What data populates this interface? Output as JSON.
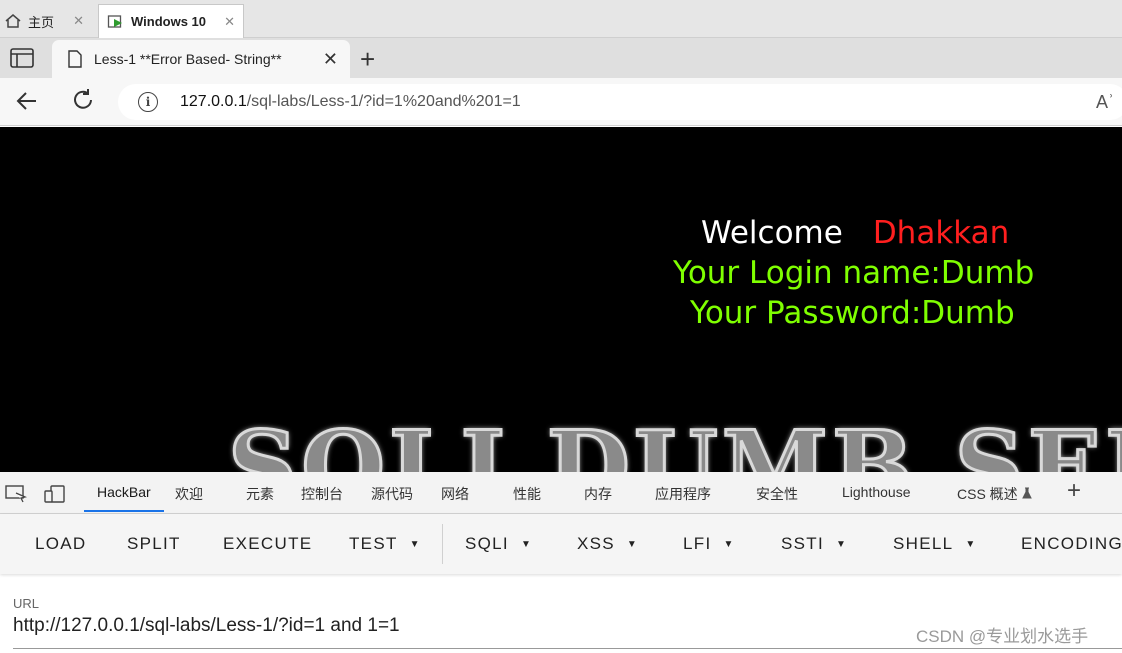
{
  "vm": {
    "tabs": [
      {
        "label": "主页",
        "icon": "home-icon"
      },
      {
        "label": "Windows 10",
        "icon": "vm-icon"
      }
    ],
    "close_glyph": "✕"
  },
  "browser": {
    "tab_title": "Less-1 **Error Based- String**",
    "close_glyph": "✕",
    "new_tab_glyph": "+",
    "url_host": "127.0.0.1",
    "url_path": "/sql-labs/Less-1/?id=1%20and%201=1",
    "info_glyph": "i",
    "read_aloud_glyph": "Aʾ"
  },
  "page": {
    "welcome": "Welcome",
    "name": "Dhakkan",
    "login": "Your Login name:Dumb",
    "password": "Your Password:Dumb",
    "banner": "SQLI DUMB SER"
  },
  "devtools": {
    "tabs": [
      "HackBar",
      "欢迎",
      "元素",
      "控制台",
      "源代码",
      "网络",
      "性能",
      "内存",
      "应用程序",
      "安全性",
      "Lighthouse",
      "CSS 概述"
    ],
    "plus": "+"
  },
  "hackbar": {
    "buttons": [
      "LOAD",
      "SPLIT",
      "EXECUTE",
      "TEST",
      "SQLI",
      "XSS",
      "LFI",
      "SSTI",
      "SHELL",
      "ENCODING"
    ],
    "url_label": "URL",
    "url_value": "http://127.0.0.1/sql-labs/Less-1/?id=1 and 1=1"
  },
  "watermark": "CSDN @专业划水选手",
  "colors": {
    "accent": "#1a73e8",
    "welcome_name": "#ff1f1f",
    "login_green": "#7fff00"
  }
}
